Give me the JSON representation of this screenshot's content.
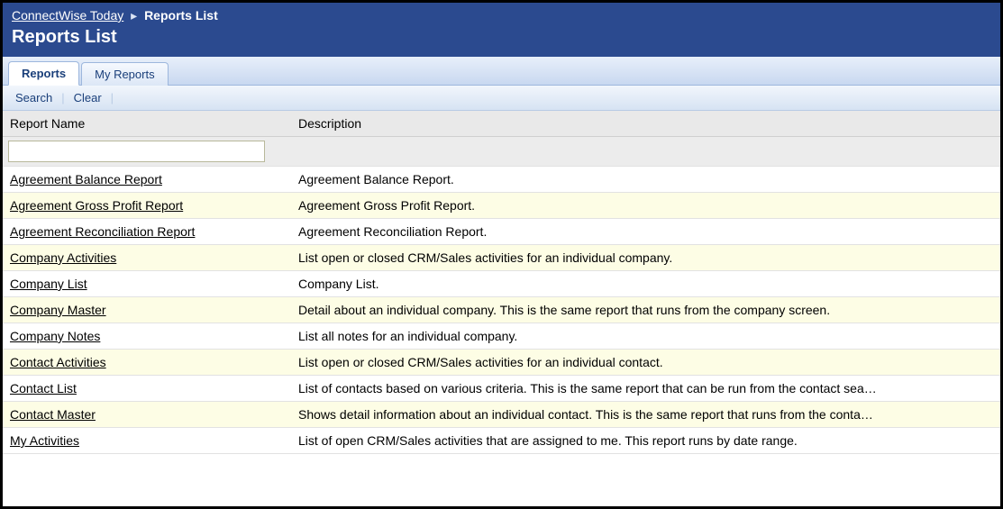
{
  "breadcrumb": {
    "root": "ConnectWise Today",
    "separator": "▸",
    "current": "Reports List"
  },
  "page_title": "Reports List",
  "tabs": [
    {
      "label": "Reports",
      "active": true
    },
    {
      "label": "My Reports",
      "active": false
    }
  ],
  "toolbar": {
    "search": "Search",
    "clear": "Clear"
  },
  "columns": {
    "name": "Report Name",
    "description": "Description"
  },
  "filter": {
    "name_value": ""
  },
  "rows": [
    {
      "name": "Agreement Balance Report",
      "description": "Agreement Balance Report."
    },
    {
      "name": "Agreement Gross Profit Report",
      "description": "Agreement Gross Profit Report."
    },
    {
      "name": "Agreement Reconciliation Report",
      "description": "Agreement Reconciliation Report."
    },
    {
      "name": "Company Activities",
      "description": "List open or closed CRM/Sales activities for an individual company."
    },
    {
      "name": "Company List",
      "description": "Company List."
    },
    {
      "name": "Company Master",
      "description": "Detail about an individual company. This is the same report that runs from the company screen."
    },
    {
      "name": "Company Notes",
      "description": "List all notes for an individual company."
    },
    {
      "name": "Contact Activities",
      "description": "List open or closed CRM/Sales activities for an individual contact."
    },
    {
      "name": "Contact List",
      "description": "List of contacts based on various criteria. This is the same report that can be run from the contact sea…"
    },
    {
      "name": "Contact Master",
      "description": "Shows detail information about an individual contact. This is the same report that runs from the conta…"
    },
    {
      "name": "My Activities",
      "description": "List of open CRM/Sales activities that are assigned to me. This report runs by date range."
    }
  ]
}
